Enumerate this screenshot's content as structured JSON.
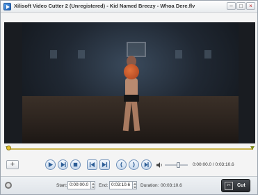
{
  "window": {
    "title": "Xilisoft Video Cutter 2 (Unregistered) - Kid Named Breezy - Whoa Dere.flv",
    "minimize_glyph": "–",
    "maximize_glyph": "□",
    "close_glyph": "×"
  },
  "toolbar": {
    "add_glyph": "+",
    "icons": [
      "play-icon",
      "play-segment-icon",
      "stop-icon",
      "previous-frame-icon",
      "next-frame-icon",
      "set-start-icon",
      "set-end-icon",
      "skip-icon",
      "volume-icon"
    ]
  },
  "playback": {
    "time_readout": "0:00:00.0 / 0:03:10.6",
    "volume_fraction": 0.6
  },
  "trim": {
    "start_label": "Start:",
    "start_value": "0:00:00.0",
    "end_label": "End:",
    "end_value": "0:03:10.6",
    "duration_label": "Duration:",
    "duration_value": "00:03:10.6",
    "cut_label": "Cut"
  },
  "colors": {
    "timeline": "#c9b24a",
    "control_accent": "#6d8fb8",
    "cut_button": "#2f3237"
  }
}
